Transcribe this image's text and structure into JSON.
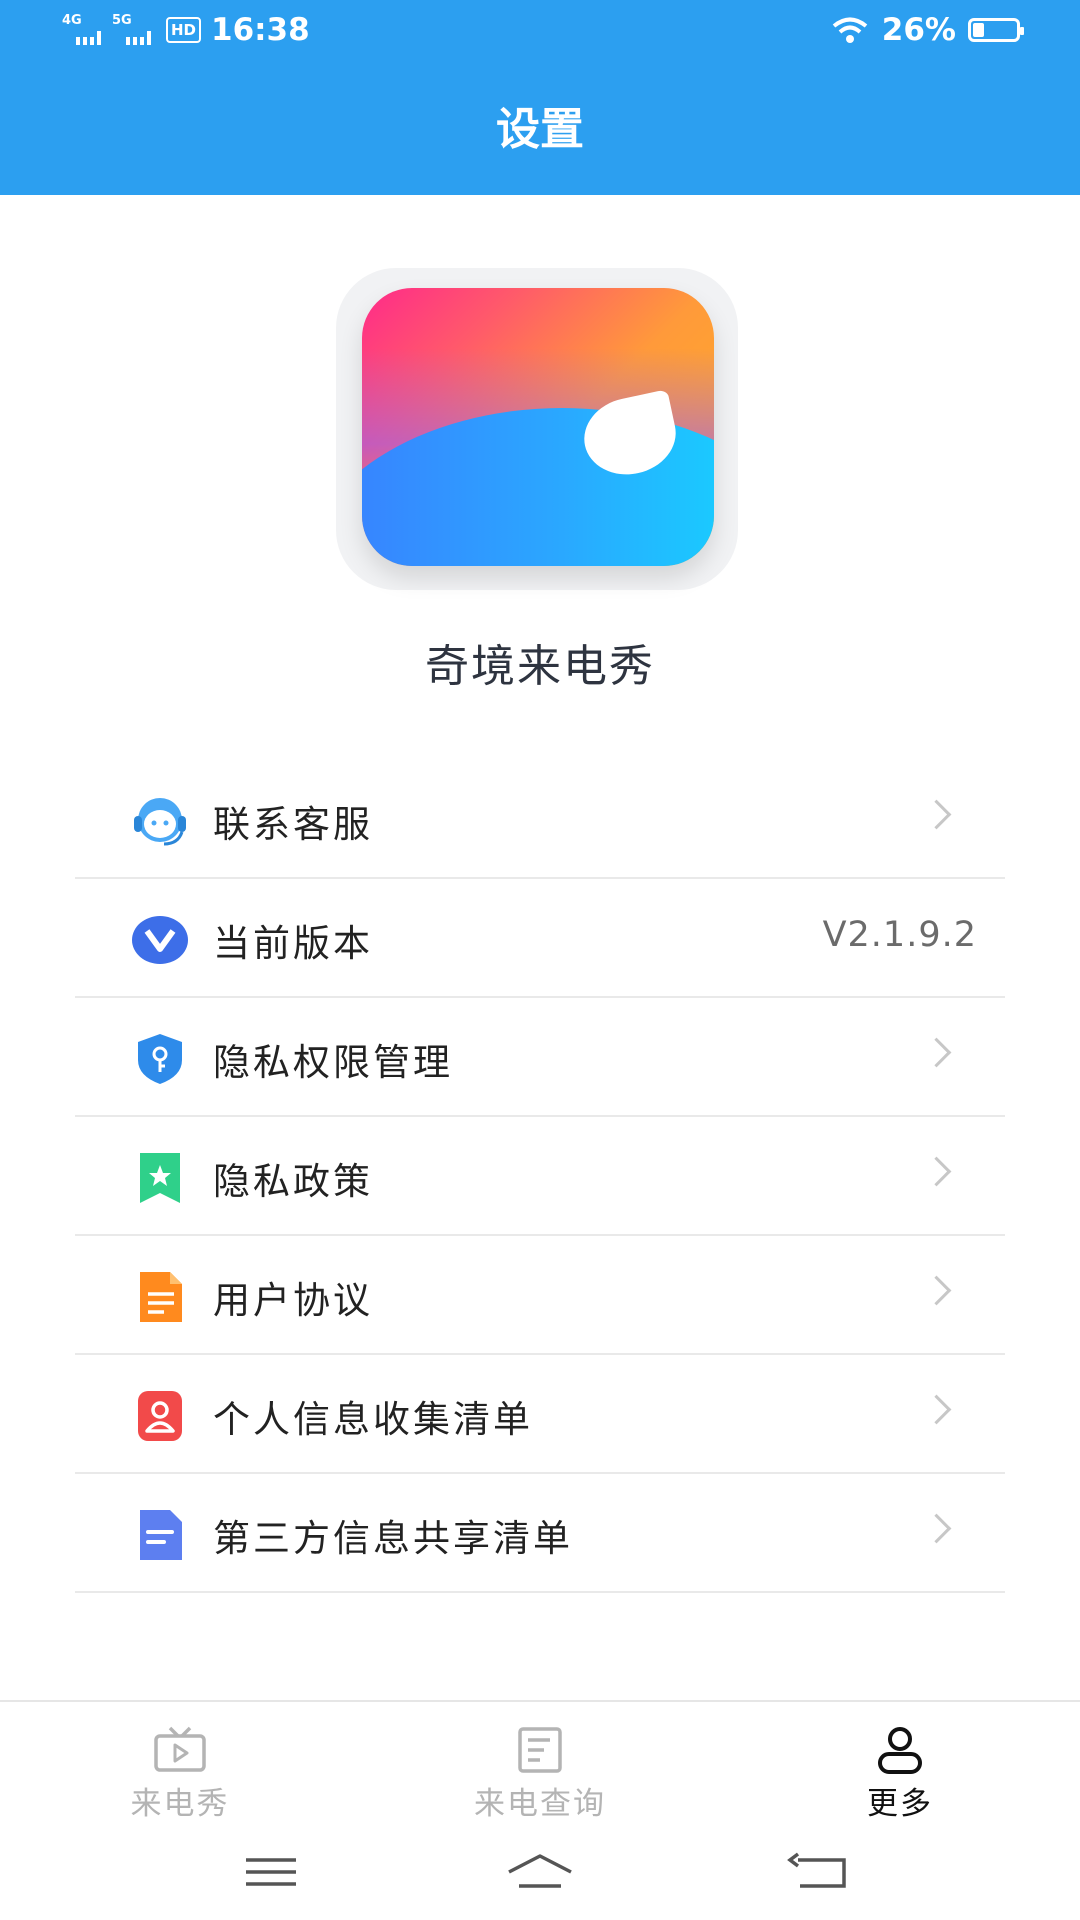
{
  "status_bar": {
    "signal1": "4G",
    "signal2": "5G",
    "hd": "HD",
    "time": "16:38",
    "battery": "26%",
    "battery_level": 0.26
  },
  "header": {
    "title": "设置"
  },
  "app": {
    "name": "奇境来电秀"
  },
  "menu": {
    "items": [
      {
        "label": "联系客服",
        "icon": "customer-service-icon",
        "has_chevron": true
      },
      {
        "label": "当前版本",
        "icon": "version-icon",
        "value": "V2.1.9.2"
      },
      {
        "label": "隐私权限管理",
        "icon": "privacy-shield-icon",
        "has_chevron": true
      },
      {
        "label": "隐私政策",
        "icon": "privacy-policy-icon",
        "has_chevron": true
      },
      {
        "label": "用户协议",
        "icon": "user-agreement-icon",
        "has_chevron": true
      },
      {
        "label": "个人信息收集清单",
        "icon": "personal-info-icon",
        "has_chevron": true
      },
      {
        "label": "第三方信息共享清单",
        "icon": "third-party-share-icon",
        "has_chevron": true
      }
    ]
  },
  "bottom_nav": {
    "tabs": [
      {
        "label": "来电秀",
        "icon": "tv-play-icon",
        "active": false
      },
      {
        "label": "来电查询",
        "icon": "document-icon",
        "active": false
      },
      {
        "label": "更多",
        "icon": "user-icon",
        "active": true
      }
    ]
  },
  "colors": {
    "header_bg": "#2c9ff0",
    "active_tab": "#111111",
    "inactive_tab": "#b4b4b4"
  }
}
